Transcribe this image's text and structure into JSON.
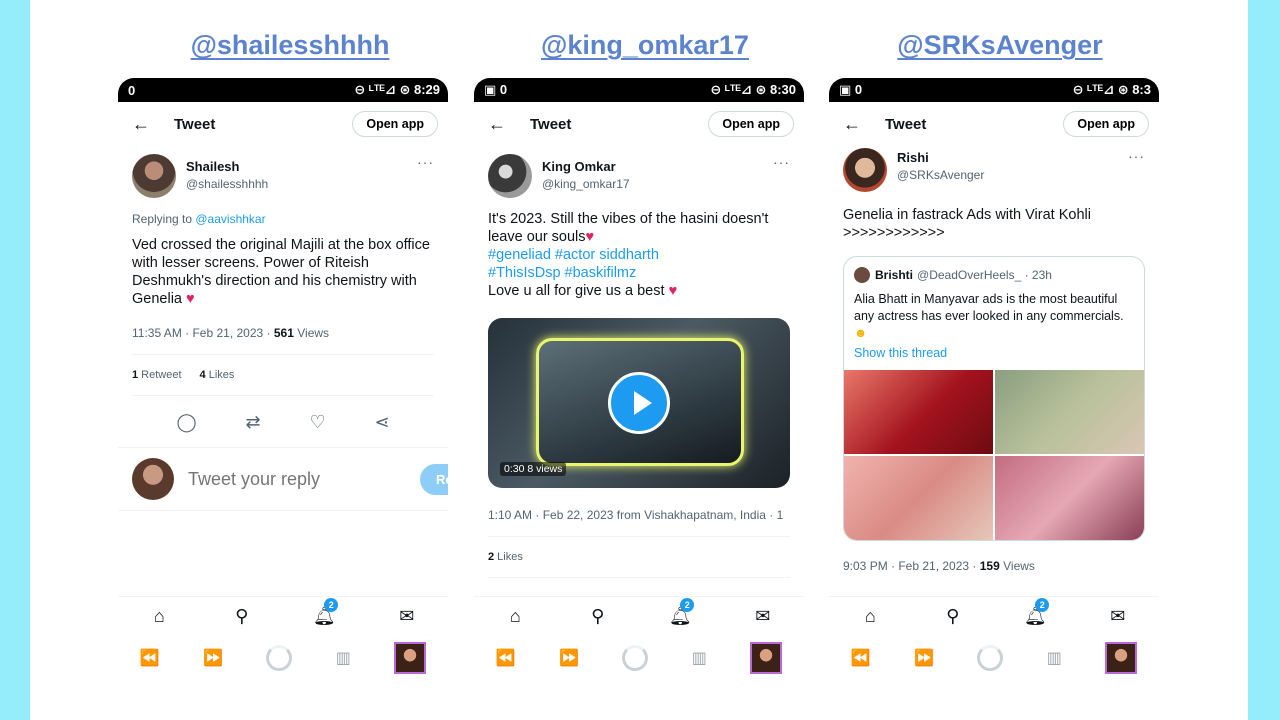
{
  "labels": [
    "@shailesshhhh",
    "@king_omkar17",
    "@SRKsAvenger"
  ],
  "common": {
    "open_app": "Open app",
    "tweet_title": "Tweet"
  },
  "phone1": {
    "status_left": "0",
    "status_right": "⊖ ᴸᵀᴱ⊿ ⊛ 8:29",
    "author_name": "Shailesh",
    "author_handle": "@shailesshhhh",
    "replying_prefix": "Replying to ",
    "replying_to": "@aavishhkar",
    "text": "Ved crossed the original Majili at the box office with lesser screens. Power of Riteish Deshmukh's direction and his chemistry with Genelia",
    "meta_prefix": "11:35 AM · Feb 21, 2023 · ",
    "views_count": "561",
    "views_label": " Views",
    "retweets_count": "1",
    "retweets_label": " Retweet",
    "likes_count": "4",
    "likes_label": " Likes",
    "reply_placeholder": "Tweet your reply",
    "reply_button": "Reply"
  },
  "phone2": {
    "status_left": "▣ 0",
    "status_right": "⊖ ᴸᵀᴱ⊿ ⊛ 8:30",
    "author_name": "King Omkar",
    "author_handle": "@king_omkar17",
    "text": "It's 2023. Still the vibes of the hasini doesn't leave our souls",
    "hashtags1": "#geneliad #actor siddharth",
    "hashtags2": "#ThisIsDsp #baskifilmz",
    "text2": "Love u all for give us a best",
    "video_duration": "0:30",
    "video_views": "8 views",
    "meta": "1:10 AM · Feb 22, 2023 from Vishakhapatnam, India · 1",
    "likes_count": "2",
    "likes_label": " Likes"
  },
  "phone3": {
    "status_left": "▣ 0",
    "status_right": "⊖ ᴸᵀᴱ⊿ ⊛ 8:3",
    "author_name": "Rishi",
    "author_handle": "@SRKsAvenger",
    "text": "Genelia in fastrack Ads with Virat Kohli >>>>>>>>>>>>",
    "quote_name": "Brishti",
    "quote_handle": "@DeadOverHeels_ · 23h",
    "quote_text": "Alia Bhatt in Manyavar ads is the most beautiful any actress has ever looked in any commercials.",
    "quote_link": "Show this thread",
    "meta_prefix": "9:03 PM · Feb 21, 2023 · ",
    "views_count": "159",
    "views_label": " Views"
  },
  "nav": {
    "notification_badge": "2"
  },
  "colors": {
    "accent": "#1d9bf0",
    "label": "#5b83cf",
    "background": "#95ecfb",
    "heart": "#e0245e"
  }
}
